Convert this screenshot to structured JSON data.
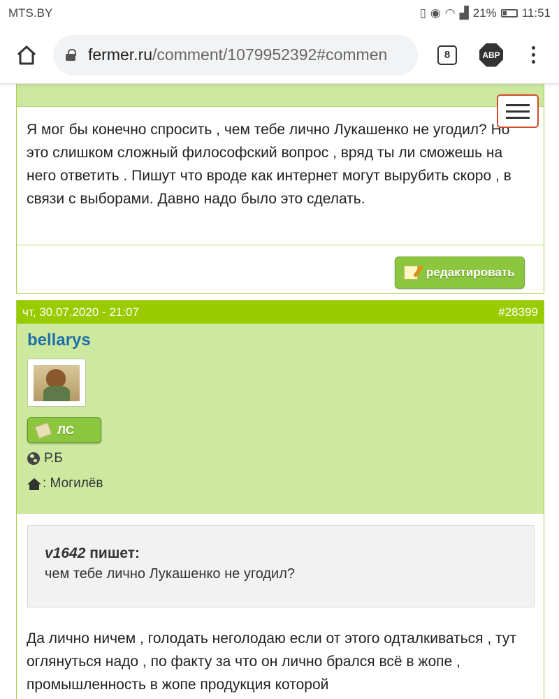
{
  "status_bar": {
    "carrier": "MTS.BY",
    "battery": "21%",
    "time": "11:51"
  },
  "browser": {
    "url_domain": "fermer.ru",
    "url_path": "/comment/1079952392#commen",
    "tabs_count": "8",
    "adblock_label": "ABP"
  },
  "post1": {
    "text": "Я мог бы конечно спросить , чем тебе лично Лукашенко не угодил? Но это слишком сложный философский вопрос , вряд ты ли сможешь на него ответить . Пишут что вроде как интернет могут вырубить скоро , в связи с выборами. Давно надо было это сделать.",
    "edit_label": "редактировать"
  },
  "post2": {
    "date": "чт, 30.07.2020 - 21:07",
    "number": "#28399",
    "username": "bellarys",
    "pm_label": "ЛС",
    "country": "Р.Б",
    "city": ": Могилёв",
    "quote_author": "v1642",
    "quote_says": " пишет:",
    "quote_text": "чем тебе лично Лукашенко не угодил?",
    "text": "Да лично ничем , голодать неголодаю если от этого одталкиваться , тут оглянуться надо , по факту за что он лично брался всё в жопе , промышленность в жопе продукция которой"
  },
  "colors": {
    "header_green": "#99cc00",
    "panel_green": "#cde9a0",
    "button_green": "#8cc63f",
    "username_blue": "#1f6fa8",
    "hamburger_border": "#d14b2a"
  }
}
